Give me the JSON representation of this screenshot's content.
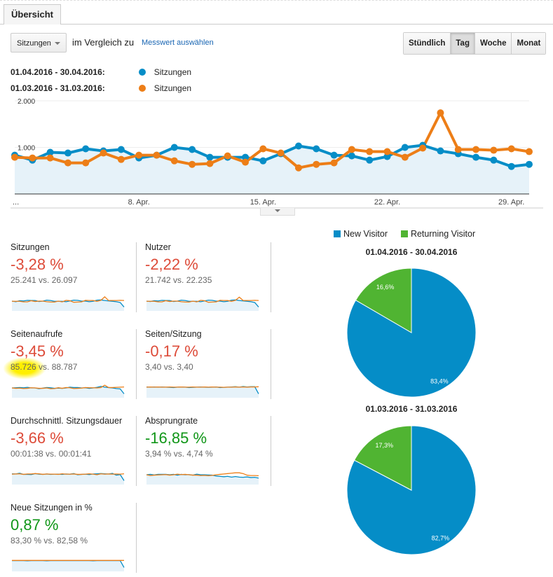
{
  "tab": {
    "label": "Übersicht"
  },
  "toolbar": {
    "metric_select": "Sitzungen",
    "compare_text": "im Vergleich zu",
    "select_metric_link": "Messwert auswählen",
    "granularity": [
      {
        "label": "Stündlich",
        "active": false
      },
      {
        "label": "Tag",
        "active": true
      },
      {
        "label": "Woche",
        "active": false
      },
      {
        "label": "Monat",
        "active": false
      }
    ]
  },
  "legend": [
    {
      "range": "01.04.2016 - 30.04.2016:",
      "metric": "Sitzungen",
      "color": "#058dc7"
    },
    {
      "range": "01.03.2016 - 31.03.2016:",
      "metric": "Sitzungen",
      "color": "#ed7e17"
    }
  ],
  "chart_data": [
    {
      "type": "line",
      "title": "",
      "xlabel": "",
      "ylabel": "",
      "ylim": [
        0,
        2000
      ],
      "yticks": [
        "1.000",
        "2.000"
      ],
      "ytick_values": [
        1000,
        2000
      ],
      "xticks": [
        {
          "label": "...",
          "index": 0
        },
        {
          "label": "8. Apr.",
          "index": 7
        },
        {
          "label": "15. Apr.",
          "index": 14
        },
        {
          "label": "22. Apr.",
          "index": 21
        },
        {
          "label": "29. Apr.",
          "index": 28
        }
      ],
      "grid": true,
      "series": [
        {
          "name": "Sitzungen (01.04.2016 - 30.04.2016)",
          "color": "#058dc7",
          "filled": true,
          "values": [
            833,
            727,
            894,
            879,
            970,
            924,
            955,
            773,
            833,
            1000,
            955,
            788,
            788,
            788,
            712,
            864,
            1030,
            970,
            833,
            818,
            727,
            803,
            1000,
            1045,
            924,
            864,
            788,
            727,
            591,
            636
          ]
        },
        {
          "name": "Sitzungen (01.03.2016 - 31.03.2016)",
          "color": "#ed7e17",
          "filled": false,
          "values": [
            788,
            773,
            773,
            667,
            667,
            879,
            742,
            833,
            833,
            712,
            636,
            652,
            818,
            682,
            970,
            879,
            561,
            636,
            667,
            955,
            909,
            909,
            788,
            985,
            1742,
            955,
            955,
            939,
            970,
            909
          ]
        }
      ]
    },
    {
      "type": "pie",
      "title": "01.04.2016 - 30.04.2016",
      "legend": "top",
      "slices": [
        {
          "label": "New Visitor",
          "value": 83.4,
          "text": "83,4%",
          "color": "#058dc7"
        },
        {
          "label": "Returning Visitor",
          "value": 16.6,
          "text": "16,6%",
          "color": "#50b432"
        }
      ]
    },
    {
      "type": "pie",
      "title": "01.03.2016 - 31.03.2016",
      "slices": [
        {
          "label": "New Visitor",
          "value": 82.7,
          "text": "82,7%",
          "color": "#058dc7"
        },
        {
          "label": "Returning Visitor",
          "value": 17.3,
          "text": "17,3%",
          "color": "#50b432"
        }
      ]
    }
  ],
  "pie_legend": [
    {
      "label": "New Visitor",
      "color": "#058dc7"
    },
    {
      "label": "Returning Visitor",
      "color": "#50b432"
    }
  ],
  "metrics": [
    {
      "name": "Sitzungen",
      "change": "-3,28 %",
      "trend": "neg",
      "compare": "25.241 vs. 26.097",
      "spark_a": [
        50,
        47,
        52,
        51,
        54,
        53,
        53,
        48,
        50,
        55,
        53,
        49,
        49,
        49,
        47,
        51,
        55,
        54,
        50,
        50,
        47,
        49,
        55,
        56,
        53,
        51,
        49,
        47,
        43,
        20
      ],
      "spark_b": [
        49,
        49,
        49,
        46,
        46,
        52,
        48,
        50,
        50,
        47,
        45,
        45,
        50,
        46,
        54,
        52,
        44,
        45,
        46,
        54,
        53,
        53,
        49,
        54,
        72,
        53,
        53,
        53,
        54,
        53
      ]
    },
    {
      "name": "Nutzer",
      "change": "-2,22 %",
      "trend": "neg",
      "compare": "21.742 vs. 22.235",
      "spark_a": [
        50,
        48,
        52,
        51,
        54,
        53,
        53,
        48,
        50,
        55,
        53,
        49,
        49,
        49,
        47,
        51,
        55,
        54,
        50,
        50,
        47,
        49,
        55,
        56,
        53,
        51,
        49,
        47,
        43,
        20
      ],
      "spark_b": [
        49,
        49,
        49,
        46,
        46,
        52,
        48,
        50,
        50,
        47,
        45,
        45,
        50,
        46,
        54,
        52,
        44,
        45,
        46,
        54,
        53,
        53,
        49,
        54,
        70,
        53,
        53,
        53,
        54,
        53
      ]
    },
    {
      "name": "Seitenaufrufe",
      "change": "-3,45 %",
      "trend": "neg",
      "compare": "85.726 vs. 88.787",
      "spark_a": [
        50,
        51,
        52,
        51,
        53,
        50,
        50,
        46,
        49,
        52,
        51,
        48,
        49,
        48,
        50,
        54,
        52,
        52,
        50,
        51,
        48,
        50,
        53,
        58,
        54,
        52,
        50,
        47,
        45,
        20
      ],
      "spark_b": [
        50,
        48,
        49,
        47,
        48,
        51,
        50,
        48,
        48,
        50,
        46,
        47,
        51,
        48,
        52,
        51,
        47,
        48,
        49,
        52,
        51,
        51,
        50,
        52,
        64,
        52,
        52,
        53,
        54,
        55
      ]
    },
    {
      "name": "Seiten/Sitzung",
      "change": "-0,17 %",
      "trend": "neg",
      "compare": "3,40 vs. 3,40",
      "spark_a": [
        55,
        54,
        55,
        54,
        55,
        54,
        53,
        52,
        54,
        55,
        54,
        52,
        53,
        54,
        55,
        54,
        53,
        54,
        55,
        52,
        53,
        54,
        55,
        56,
        54,
        57,
        55,
        56,
        56,
        20
      ],
      "spark_b": [
        54,
        55,
        54,
        55,
        54,
        54,
        55,
        54,
        54,
        55,
        54,
        54,
        55,
        54,
        54,
        55,
        54,
        55,
        54,
        54,
        53,
        54,
        54,
        55,
        54,
        55,
        54,
        55,
        55,
        56
      ]
    },
    {
      "name": "Durchschnittl. Sitzungsdauer",
      "change": "-3,66 %",
      "trend": "neg",
      "compare": "00:01:38 vs. 00:01:41",
      "spark_a": [
        55,
        54,
        58,
        52,
        52,
        51,
        56,
        53,
        52,
        54,
        52,
        53,
        53,
        52,
        54,
        53,
        56,
        50,
        52,
        53,
        51,
        54,
        55,
        56,
        55,
        54,
        57,
        48,
        51,
        20
      ],
      "spark_b": [
        53,
        54,
        55,
        52,
        54,
        54,
        56,
        55,
        52,
        54,
        53,
        53,
        52,
        55,
        53,
        53,
        54,
        52,
        52,
        53,
        55,
        53,
        50,
        55,
        53,
        54,
        53,
        54,
        53,
        55
      ]
    },
    {
      "name": "Absprungrate",
      "change": "-16,85 %",
      "trend": "pos",
      "compare": "3,94 % vs. 4,74 %",
      "spark_a": [
        50,
        52,
        49,
        52,
        52,
        52,
        50,
        52,
        48,
        52,
        50,
        51,
        48,
        53,
        50,
        50,
        49,
        48,
        44,
        42,
        40,
        42,
        38,
        41,
        38,
        37,
        39,
        36,
        37,
        33
      ],
      "spark_b": [
        50,
        46,
        48,
        49,
        50,
        51,
        48,
        50,
        53,
        51,
        52,
        50,
        48,
        48,
        46,
        47,
        45,
        47,
        50,
        52,
        54,
        56,
        58,
        60,
        60,
        56,
        48,
        46,
        46,
        45
      ]
    },
    {
      "name": "Neue Sitzungen in %",
      "change": "0,87 %",
      "trend": "pos",
      "compare": "83,30 % vs. 82,58 %",
      "spark_a": [
        55,
        55,
        55,
        55,
        54,
        55,
        55,
        55,
        55,
        54,
        55,
        55,
        55,
        55,
        55,
        55,
        55,
        55,
        55,
        55,
        55,
        54,
        55,
        55,
        55,
        55,
        55,
        55,
        55,
        20
      ],
      "spark_b": [
        56,
        56,
        56,
        56,
        56,
        56,
        56,
        56,
        56,
        56,
        56,
        56,
        56,
        56,
        56,
        56,
        56,
        56,
        56,
        56,
        56,
        56,
        56,
        56,
        56,
        56,
        56,
        56,
        56,
        56
      ]
    }
  ]
}
